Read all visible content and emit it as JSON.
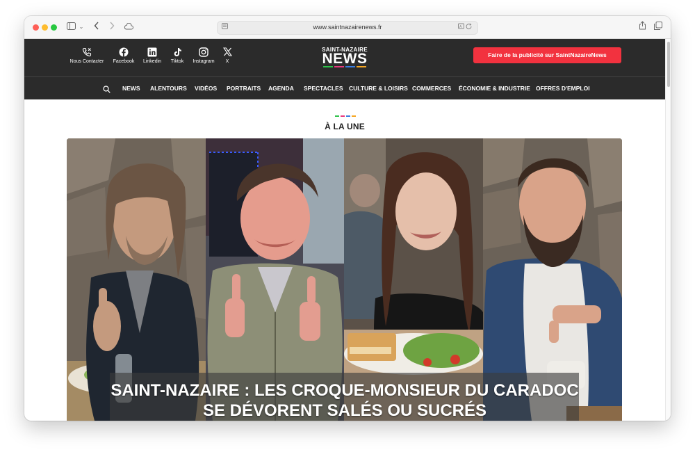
{
  "browser": {
    "url": "www.saintnazairenews.fr"
  },
  "header": {
    "social": [
      {
        "label": "Nous Contacter",
        "icon": "phone-icon"
      },
      {
        "label": "Facebook",
        "icon": "facebook-icon"
      },
      {
        "label": "Linkedin",
        "icon": "linkedin-icon"
      },
      {
        "label": "Tiktok",
        "icon": "tiktok-icon"
      },
      {
        "label": "Instagram",
        "icon": "instagram-icon"
      },
      {
        "label": "X",
        "icon": "x-icon"
      }
    ],
    "logo_top": "SAINT-NAZAIRE",
    "logo_main": "NEWS",
    "ad_button": "Faire de la publicité sur SaintNazaireNews",
    "colors": {
      "header_bg": "#2b2b2b",
      "ad_button": "#f2323f",
      "logo_bars": [
        "#2ec24a",
        "#e8397d",
        "#3a7de0",
        "#f5a623"
      ]
    }
  },
  "nav": {
    "items": [
      "NEWS",
      "ALENTOURS",
      "VIDÉOS",
      "PORTRAITS",
      "AGENDA",
      "SPECTACLES",
      "CULTURE & LOISIRS",
      "COMMERCES",
      "ÉCONOMIE & INDUSTRIE",
      "OFFRES D'EMPLOI"
    ]
  },
  "section": {
    "title": "À LA UNE"
  },
  "hero": {
    "headline_line1": "SAINT-NAZAIRE : LES CROQUE-MONSIEUR DU CARADOC",
    "headline_line2": "SE DÉVORENT SALÉS OU SUCRÉS"
  }
}
